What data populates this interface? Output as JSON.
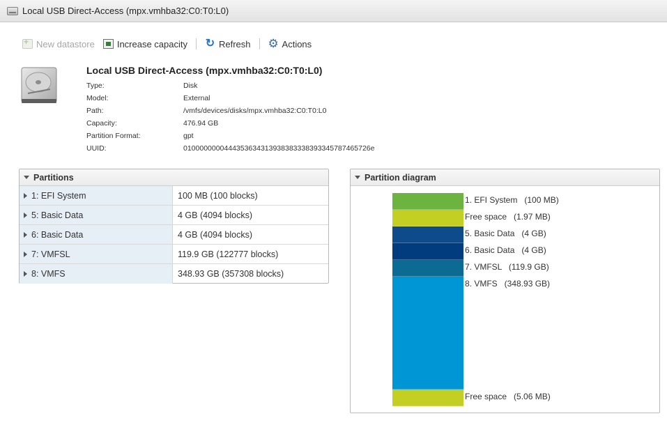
{
  "window": {
    "title": "Local USB Direct-Access (mpx.vmhba32:C0:T0:L0)"
  },
  "toolbar": {
    "new_datastore": "New datastore",
    "increase_capacity": "Increase capacity",
    "refresh": "Refresh",
    "actions": "Actions"
  },
  "device": {
    "title": "Local USB Direct-Access (mpx.vmhba32:C0:T0:L0)",
    "fields": [
      {
        "label": "Type:",
        "value": "Disk"
      },
      {
        "label": "Model:",
        "value": "External"
      },
      {
        "label": "Path:",
        "value": "/vmfs/devices/disks/mpx.vmhba32:C0:T0:L0"
      },
      {
        "label": "Capacity:",
        "value": "476.94 GB"
      },
      {
        "label": "Partition Format:",
        "value": "gpt"
      },
      {
        "label": "UUID:",
        "value": "0100000000444353634313938383338393345787465726e"
      }
    ]
  },
  "partitions": {
    "header": "Partitions",
    "rows": [
      {
        "name": "1: EFI System",
        "size": "100 MB (100 blocks)"
      },
      {
        "name": "5: Basic Data",
        "size": "4 GB (4094 blocks)"
      },
      {
        "name": "6: Basic Data",
        "size": "4 GB (4094 blocks)"
      },
      {
        "name": "7: VMFSL",
        "size": "119.9 GB (122777 blocks)"
      },
      {
        "name": "8: VMFS",
        "size": "348.93 GB (357308 blocks)"
      }
    ]
  },
  "diagram": {
    "header": "Partition diagram",
    "segments": [
      {
        "label": "1. EFI System   (100 MB)",
        "color": "#6db33f"
      },
      {
        "label": "Free space   (1.97 MB)",
        "color": "#c3cf22"
      },
      {
        "label": "5. Basic Data   (4 GB)",
        "color": "#0d4b8a"
      },
      {
        "label": "6. Basic Data   (4 GB)",
        "color": "#003c7e"
      },
      {
        "label": "7. VMFSL   (119.9 GB)",
        "color": "#0b6b93"
      },
      {
        "label": "8. VMFS   (348.93 GB)",
        "color": "#0096d6"
      },
      {
        "label": "Free space   (5.06 MB)",
        "color": "#c3cf22"
      }
    ]
  }
}
